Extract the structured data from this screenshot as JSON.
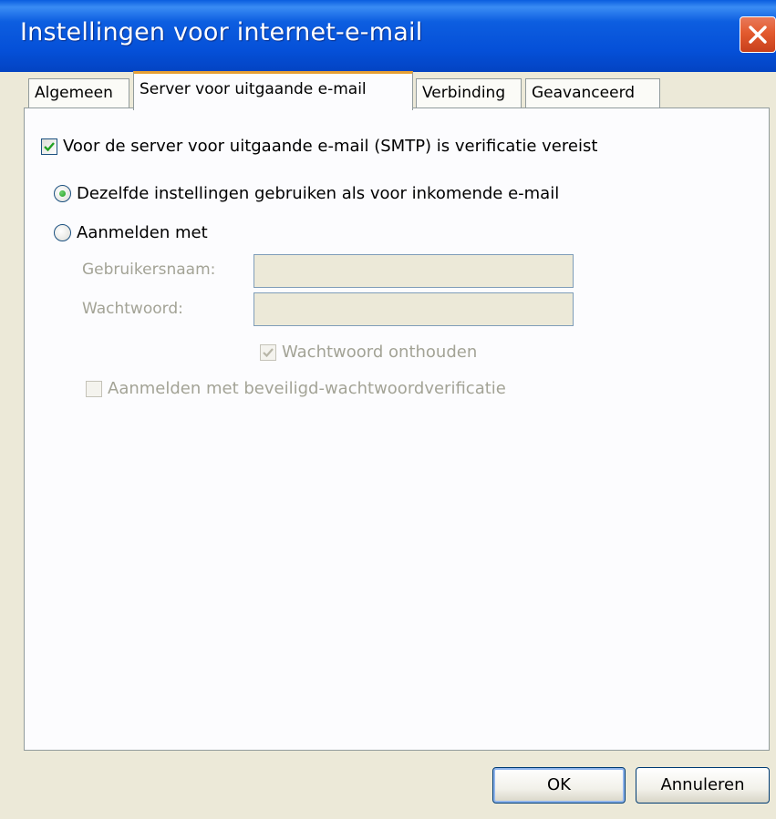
{
  "window": {
    "title": "Instellingen voor internet-e-mail",
    "close_icon": "close-icon"
  },
  "tabs": [
    {
      "label": "Algemeen",
      "active": false
    },
    {
      "label": "Server voor uitgaande e-mail",
      "active": true
    },
    {
      "label": "Verbinding",
      "active": false
    },
    {
      "label": "Geavanceerd",
      "active": false
    }
  ],
  "smtp_auth": {
    "label": "Voor de server voor uitgaande e-mail (SMTP) is verificatie vereist",
    "checked": true
  },
  "options": {
    "same_settings": {
      "label": "Dezelfde instellingen gebruiken als voor inkomende e-mail",
      "selected": true
    },
    "login_with": {
      "label": "Aanmelden met",
      "selected": false
    }
  },
  "fields": {
    "username": {
      "label": "Gebruikersnaam:",
      "value": ""
    },
    "password": {
      "label": "Wachtwoord:",
      "value": ""
    }
  },
  "remember_password": {
    "label": "Wachtwoord onthouden",
    "checked": true,
    "enabled": false
  },
  "spa": {
    "label": "Aanmelden met beveiligd-wachtwoordverificatie",
    "checked": false,
    "enabled": false
  },
  "buttons": {
    "ok": "OK",
    "cancel": "Annuleren"
  },
  "colors": {
    "titlebar": "#0550d8",
    "face": "#ece9d8",
    "active_tab_accent": "#e6a035"
  }
}
